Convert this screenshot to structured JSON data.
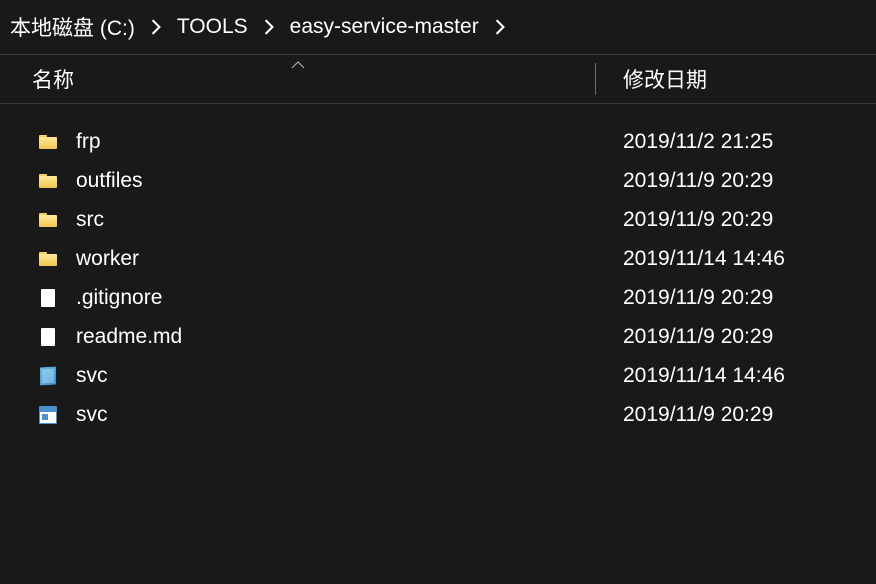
{
  "breadcrumb": {
    "items": [
      {
        "label": "本地磁盘 (C:)"
      },
      {
        "label": "TOOLS"
      },
      {
        "label": "easy-service-master"
      }
    ]
  },
  "columns": {
    "name": "名称",
    "date": "修改日期"
  },
  "files": [
    {
      "name": "frp",
      "date": "2019/11/2 21:25",
      "icon": "folder"
    },
    {
      "name": "outfiles",
      "date": "2019/11/9 20:29",
      "icon": "folder"
    },
    {
      "name": "src",
      "date": "2019/11/9 20:29",
      "icon": "folder"
    },
    {
      "name": "worker",
      "date": "2019/11/14 14:46",
      "icon": "folder"
    },
    {
      "name": ".gitignore",
      "date": "2019/11/9 20:29",
      "icon": "file"
    },
    {
      "name": "readme.md",
      "date": "2019/11/9 20:29",
      "icon": "file"
    },
    {
      "name": "svc",
      "date": "2019/11/14 14:46",
      "icon": "cfg"
    },
    {
      "name": "svc",
      "date": "2019/11/9 20:29",
      "icon": "exe"
    }
  ]
}
